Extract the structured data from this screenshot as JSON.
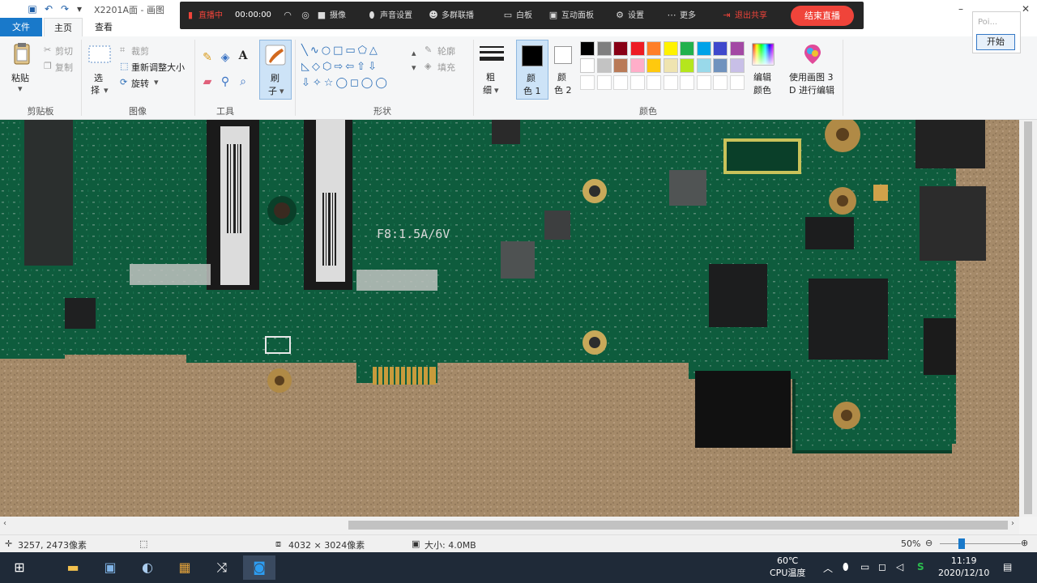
{
  "window": {
    "title": "X2201A面 - 画图",
    "min_icon": "minimize-icon",
    "close_icon": "close-icon"
  },
  "live_toolbar": {
    "status": "直播中",
    "timer": "00:00:00",
    "items": [
      {
        "label": "",
        "icon": "wifi-icon"
      },
      {
        "label": "",
        "icon": "face-icon"
      },
      {
        "label": "摄像",
        "icon": "camera-icon"
      },
      {
        "label": "声音设置",
        "icon": "mic-icon"
      },
      {
        "label": "多群联播",
        "icon": "group-icon"
      },
      {
        "label": "白板",
        "icon": "whiteboard-icon"
      },
      {
        "label": "互动面板",
        "icon": "chat-icon"
      },
      {
        "label": "设置",
        "icon": "gear-icon"
      },
      {
        "label": "更多",
        "icon": "more-icon"
      },
      {
        "label": "退出共享",
        "icon": "exit-share-icon"
      }
    ],
    "end_button": "结束直播"
  },
  "tabs": {
    "file": "文件",
    "home": "主页",
    "view": "查看"
  },
  "ribbon": {
    "clipboard": {
      "label": "剪贴板",
      "paste": "粘贴",
      "cut": "剪切",
      "copy": "复制"
    },
    "image": {
      "label": "图像",
      "select": "选",
      "select2": "择",
      "crop": "裁剪",
      "resize": "重新调整大小",
      "rotate": "旋转"
    },
    "tools": {
      "label": "工具"
    },
    "brushes": {
      "label1": "刷",
      "label2": "子"
    },
    "shapes": {
      "label": "形状",
      "outline": "轮廓",
      "fill": "填充"
    },
    "size": {
      "label1": "粗",
      "label2": "细"
    },
    "color1": {
      "label1": "颜",
      "label2": "色 1"
    },
    "color2": {
      "label1": "颜",
      "label2": "色 2"
    },
    "colors": {
      "label": "颜色",
      "palette_row1": [
        "#000000",
        "#7f7f7f",
        "#880015",
        "#ed1c24",
        "#ff7f27",
        "#fff200",
        "#22b14c",
        "#00a2e8",
        "#3f48cc",
        "#a349a4"
      ],
      "palette_row2": [
        "#ffffff",
        "#c3c3c3",
        "#b97a57",
        "#ffaec9",
        "#ffc90e",
        "#efe4b0",
        "#b5e61d",
        "#99d9ea",
        "#7092be",
        "#c8bfe7"
      ],
      "edit_colors1": "编辑",
      "edit_colors2": "颜色",
      "paint3d1": "使用画图 3",
      "paint3d2": "D 进行编辑"
    }
  },
  "popup": {
    "input_placeholder": "Poi...",
    "start_button": "开始"
  },
  "canvas": {
    "silkscreen": "F8:1.5A/6V"
  },
  "status": {
    "cursor": "3257, 2473像素",
    "image_size": "4032 × 3024像素",
    "file_size": "大小: 4.0MB",
    "zoom": "50%"
  },
  "taskbar": {
    "temp": "60℃",
    "temp_label": "CPU温度",
    "time": "11:19",
    "date": "2020/12/10"
  }
}
